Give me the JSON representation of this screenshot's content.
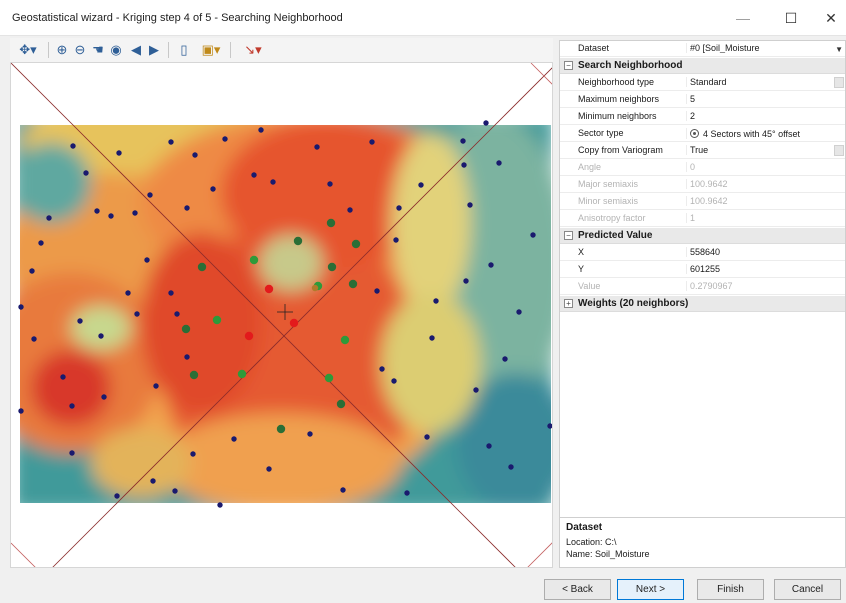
{
  "window": {
    "title": "Geostatistical wizard - Kriging step 4 of 5 - Searching Neighborhood",
    "min": "—",
    "max": "☐",
    "close": "✕"
  },
  "toolbar": {
    "items": [
      "pan-select-icon",
      "zoom-in-icon",
      "zoom-out-icon",
      "pan-icon",
      "full-extent-icon",
      "back-icon",
      "forward-icon",
      "layout-icon",
      "legend-icon",
      "identify-icon"
    ]
  },
  "properties": {
    "dataset": {
      "label": "Dataset",
      "value": "#0 [Soil_Moisture"
    },
    "search_neighborhood": {
      "header": "Search Neighborhood",
      "rows": [
        {
          "name": "Neighborhood type",
          "value": "Standard",
          "enabled": true
        },
        {
          "name": "Maximum neighbors",
          "value": "5",
          "enabled": true
        },
        {
          "name": "Minimum neighbors",
          "value": "2",
          "enabled": true
        },
        {
          "name": "Sector type",
          "value": "4 Sectors with 45° offset",
          "enabled": true
        },
        {
          "name": "Copy from Variogram",
          "value": "True",
          "enabled": true
        },
        {
          "name": "Angle",
          "value": "0",
          "enabled": false
        },
        {
          "name": "Major semiaxis",
          "value": "100.9642",
          "enabled": false
        },
        {
          "name": "Minor semiaxis",
          "value": "100.9642",
          "enabled": false
        },
        {
          "name": "Anisotropy factor",
          "value": "1",
          "enabled": false
        }
      ]
    },
    "predicted_value": {
      "header": "Predicted Value",
      "rows": [
        {
          "name": "X",
          "value": "558640",
          "enabled": true
        },
        {
          "name": "Y",
          "value": "601255",
          "enabled": true
        },
        {
          "name": "Value",
          "value": "0.2790967",
          "enabled": false
        }
      ]
    },
    "weights": {
      "header": "Weights (20 neighbors)"
    }
  },
  "info": {
    "title": "Dataset",
    "location": "Location: C:\\",
    "name": "Name: Soil_Moisture"
  },
  "buttons": {
    "back": "< Back",
    "next": "Next >",
    "finish": "Finish",
    "cancel": "Cancel"
  },
  "colors": {
    "accent": "#0078d7",
    "neighbor_green": "#2e9a3a",
    "neighbor_dark": "#2a6e36",
    "neighbor_red": "#e31a1c",
    "point_navy": "#1a1a6e"
  }
}
